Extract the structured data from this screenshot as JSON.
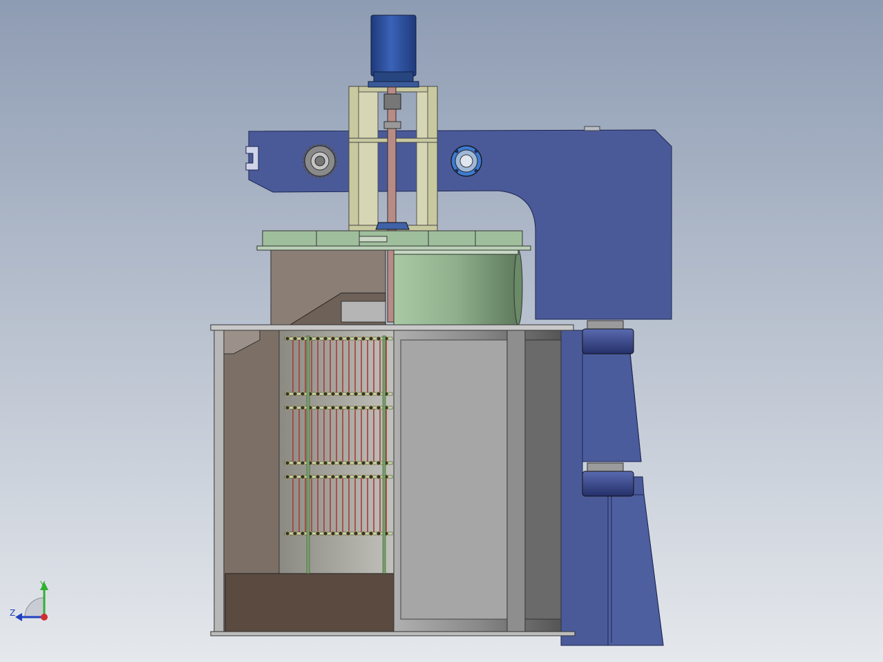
{
  "viewport": {
    "background_top": "#8e9cb3",
    "background_bottom": "#e5e8ec"
  },
  "colors": {
    "frame_blue": "#4a5a99",
    "frame_blue_dark": "#3a4785",
    "motor_blue": "#2f4f9e",
    "support_khaki": "#c9c9a0",
    "lid_green": "#9fbf9c",
    "drum_gray": "#9a9a9a",
    "cut_brown": "#7c6f66",
    "heater_red": "#a83a3a",
    "rod_green": "#7aa06a",
    "base_dark_brown": "#5a4a40"
  },
  "parts": [
    "drive-motor",
    "motor-support-frame",
    "lift-arm",
    "sprocket",
    "bearing-flange",
    "lid-plate",
    "drum",
    "furnace-shell",
    "heating-element-array",
    "column-pedestal",
    "guide-roller"
  ],
  "triad": {
    "x_label": "",
    "y_label": "Y",
    "z_label": "Z",
    "x_color": "#d03030",
    "y_color": "#30b030",
    "z_color": "#2040c0"
  }
}
